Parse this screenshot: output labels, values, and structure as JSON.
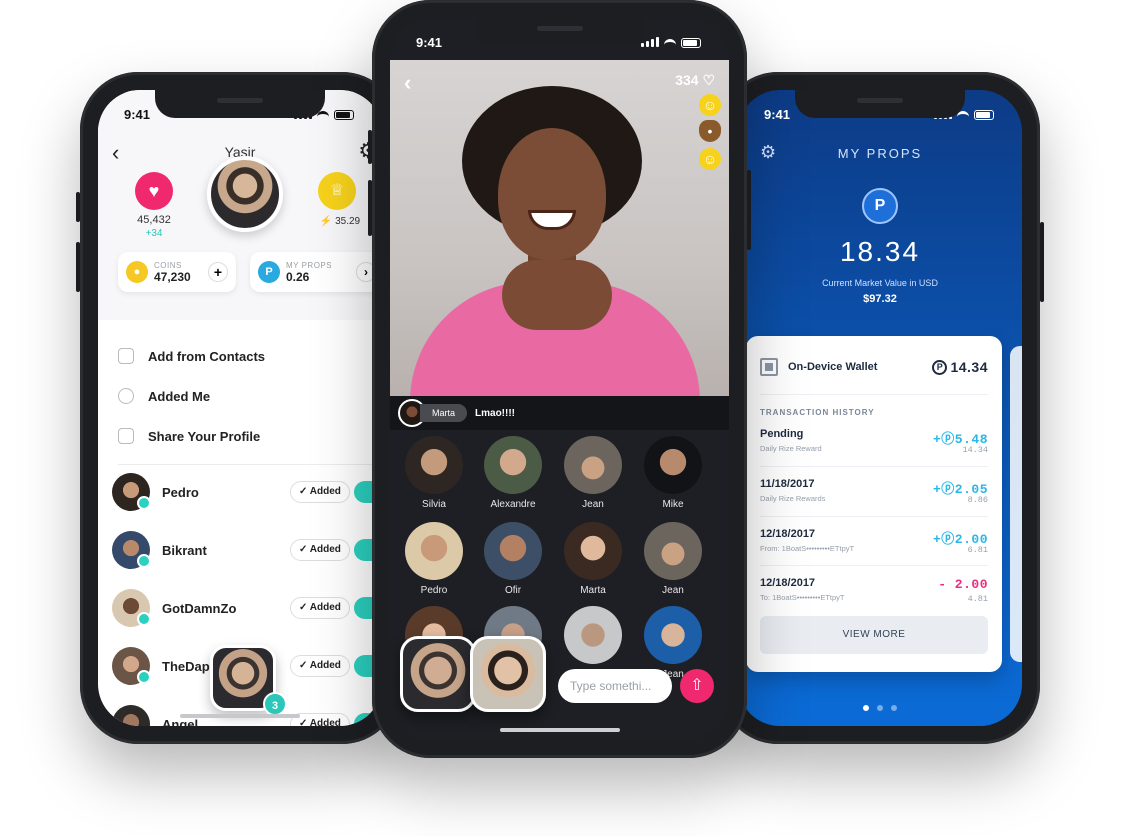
{
  "status": {
    "time": "9:41"
  },
  "left": {
    "title": "Yasir",
    "hearts": "45,432",
    "hearts_delta": "+34",
    "crown_value": "35.29",
    "coins_label": "COINS",
    "coins_value": "47,230",
    "props_label": "MY PROPS",
    "props_value": "0.26",
    "menu": [
      {
        "label": "Add from Contacts"
      },
      {
        "label": "Added Me"
      },
      {
        "label": "Share Your Profile"
      }
    ],
    "friends": [
      {
        "name": "Pedro",
        "status": "Added"
      },
      {
        "name": "Bikrant",
        "status": "Added"
      },
      {
        "name": "GotDamnZo",
        "status": "Added"
      },
      {
        "name": "TheDap",
        "status": "Added"
      },
      {
        "name": "Angel",
        "status": "Added"
      }
    ],
    "float_badge": "3"
  },
  "middle": {
    "likes": "334",
    "chat_user": "Marta",
    "chat_message": "Lmao!!!!",
    "participants": [
      {
        "name": "Silvia"
      },
      {
        "name": "Alexandre"
      },
      {
        "name": "Jean"
      },
      {
        "name": "Mike"
      },
      {
        "name": "Pedro"
      },
      {
        "name": "Ofir"
      },
      {
        "name": "Marta"
      },
      {
        "name": "Jean"
      },
      {
        "name": ""
      },
      {
        "name": ""
      },
      {
        "name": ""
      },
      {
        "name": "Jean"
      }
    ],
    "input_placeholder": "Type somethi..."
  },
  "right": {
    "title": "MY PROPS",
    "amount": "18.34",
    "market_label": "Current Market Value in USD",
    "usd_value": "$97.32",
    "wallet_label": "On-Device Wallet",
    "wallet_balance": "14.34",
    "history_label": "TRANSACTION HISTORY",
    "transactions": [
      {
        "date": "Pending",
        "sub": "Daily Rize Reward",
        "amount": "+ⓟ5.48",
        "balance": "14.34",
        "sign": "pos"
      },
      {
        "date": "11/18/2017",
        "sub": "Daily Rize Rewards",
        "amount": "+ⓟ2.05",
        "balance": "8.86",
        "sign": "pos"
      },
      {
        "date": "12/18/2017",
        "sub": "From: 1BoatS•••••••••ETtpyT",
        "amount": "+ⓟ2.00",
        "balance": "6.81",
        "sign": "pos"
      },
      {
        "date": "12/18/2017",
        "sub": "To: 1BoatS•••••••••ETtpyT",
        "amount": "- 2.00",
        "balance": "4.81",
        "sign": "neg"
      }
    ],
    "view_more": "VIEW MORE"
  },
  "colors": {
    "accent_pink": "#f0286e",
    "accent_teal": "#2bd1c0",
    "wallet_blue": "#0b56b4"
  }
}
